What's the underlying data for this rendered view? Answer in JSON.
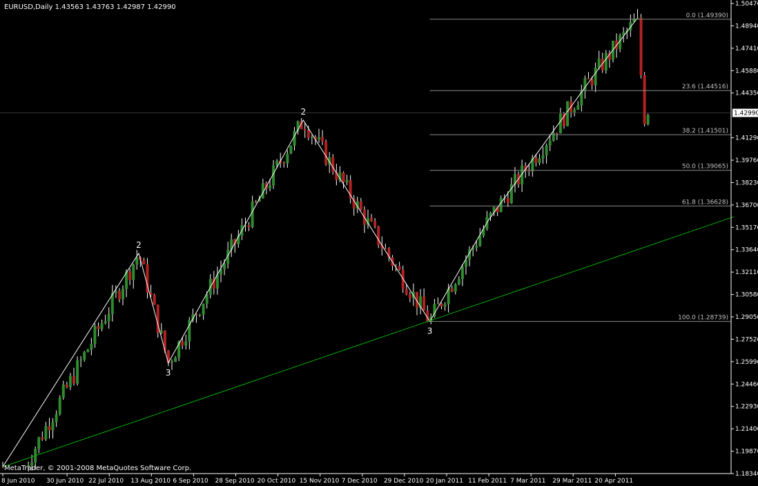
{
  "chart_data": {
    "type": "candlestick",
    "symbol_header": "EURUSD,Daily  1.43563 1.43763 1.42987 1.42990",
    "copyright": "MetaTrader, © 2001-2008 MetaQuotes Software Corp.",
    "ylim": [
      1.1834,
      1.5047
    ],
    "current_price": 1.4299,
    "current_price_label": "1.42990",
    "y_ticks": [
      "1.50470",
      "1.48940",
      "1.47410",
      "1.45880",
      "1.44350",
      "1.41290",
      "1.39760",
      "1.38230",
      "1.36700",
      "1.35170",
      "1.33640",
      "1.32110",
      "1.30580",
      "1.29050",
      "1.27520",
      "1.25990",
      "1.24460",
      "1.22930",
      "1.21400",
      "1.19870",
      "1.18340"
    ],
    "x_labels": [
      "8 Jun 2010",
      "30 Jun 2010",
      "22 Jul 2010",
      "13 Aug 2010",
      "6 Sep 2010",
      "28 Sep 2010",
      "20 Oct 2010",
      "15 Nov 2010",
      "7 Dec 2010",
      "29 Dec 2010",
      "20 Jan 2011",
      "11 Feb 2011",
      "7 Mar 2011",
      "29 Mar 2011",
      "20 Apr 2011"
    ],
    "fibonacci": {
      "levels": [
        {
          "label": "0.0 (1.49390)",
          "price": 1.4939
        },
        {
          "label": "23.6 (1.44516)",
          "price": 1.44516
        },
        {
          "label": "38.2 (1.41501)",
          "price": 1.41501
        },
        {
          "label": "50.0 (1.39065)",
          "price": 1.39065
        },
        {
          "label": "61.8 (1.36628)",
          "price": 1.36628
        },
        {
          "label": "100.0 (1.28739)",
          "price": 1.28739
        }
      ]
    },
    "wave_labels": [
      {
        "text": "2",
        "date_index": 2.7,
        "price": 1.334,
        "pos": "above"
      },
      {
        "text": "3",
        "date_index": 3.4,
        "price": 1.259,
        "pos": "below"
      },
      {
        "text": "2",
        "date_index": 6.6,
        "price": 1.425,
        "pos": "above"
      },
      {
        "text": "3",
        "date_index": 9.6,
        "price": 1.2874,
        "pos": "below"
      }
    ],
    "wave_lines": [
      [
        [
          0,
          1.188
        ],
        [
          2.7,
          1.334
        ],
        [
          3.4,
          1.259
        ],
        [
          6.6,
          1.425
        ],
        [
          9.6,
          1.2874
        ],
        [
          11.0,
          1.357
        ],
        [
          13.6,
          1.46
        ],
        [
          14.5,
          1.4939
        ]
      ]
    ],
    "trend_line": [
      [
        0,
        1.188
      ],
      [
        16.6,
        1.359
      ]
    ],
    "colors": {
      "bull_candle": "#2e8b2e",
      "bear_candle": "#b22222",
      "wick": "#ffffff",
      "fib_line": "#8c8c8c",
      "trend_line": "#00b000",
      "wave_line": "#ffffff",
      "axis": "#ffffff",
      "price_box_bg": "#ffffff",
      "price_box_text": "#000000"
    }
  }
}
